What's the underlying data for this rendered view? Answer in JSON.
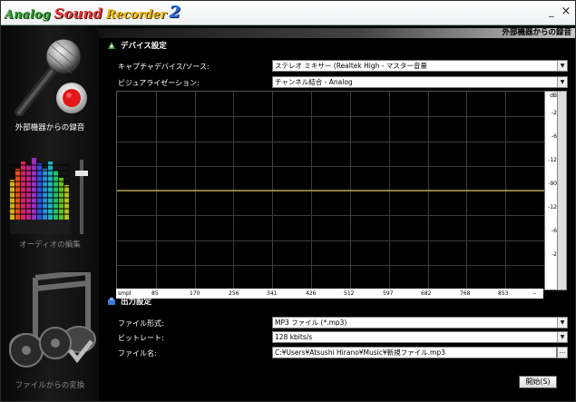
{
  "app": {
    "logo_words": [
      "Analog",
      "Sound",
      "Recorder",
      "2"
    ],
    "minimize_glyph": "_",
    "close_glyph": "×"
  },
  "sidebar": {
    "record_external": "外部機器からの録音",
    "edit_audio": "オーディオの編集",
    "convert_file": "ファイルからの変換"
  },
  "header": {
    "title": "外部機器からの録音"
  },
  "device_section": {
    "title": "デバイス設定",
    "capture_label": "キャプチャデバイス/ソース:",
    "capture_value": "ステレオ ミキサー (Realtek High - マスター音量",
    "visualization_label": "ビジュアライゼーション:",
    "visualization_value": "チャンネル結合 - Analog"
  },
  "visualizer": {
    "db_label": "dB",
    "scale_ticks": [
      "-2",
      "-6",
      "-12",
      "-90",
      "-12",
      "-6",
      "-2"
    ],
    "x_label": "smpl",
    "x_ticks": [
      "85",
      "170",
      "256",
      "341",
      "426",
      "512",
      "597",
      "682",
      "768",
      "853"
    ],
    "x_end": "--",
    "line_color": "#c8b25a",
    "grid_color": "#3c3c3c"
  },
  "output_section": {
    "title": "出力設定",
    "format_label": "ファイル形式:",
    "format_value": "MP3 ファイル (*.mp3)",
    "bitrate_label": "ビットレート:",
    "bitrate_value": "128 kbits/s",
    "filename_label": "ファイル名:",
    "filename_value": "C:¥Users¥Atsushi Hirano¥Music¥新規ファイル.mp3",
    "browse_label": "..."
  },
  "actions": {
    "start": "開始(S)"
  }
}
